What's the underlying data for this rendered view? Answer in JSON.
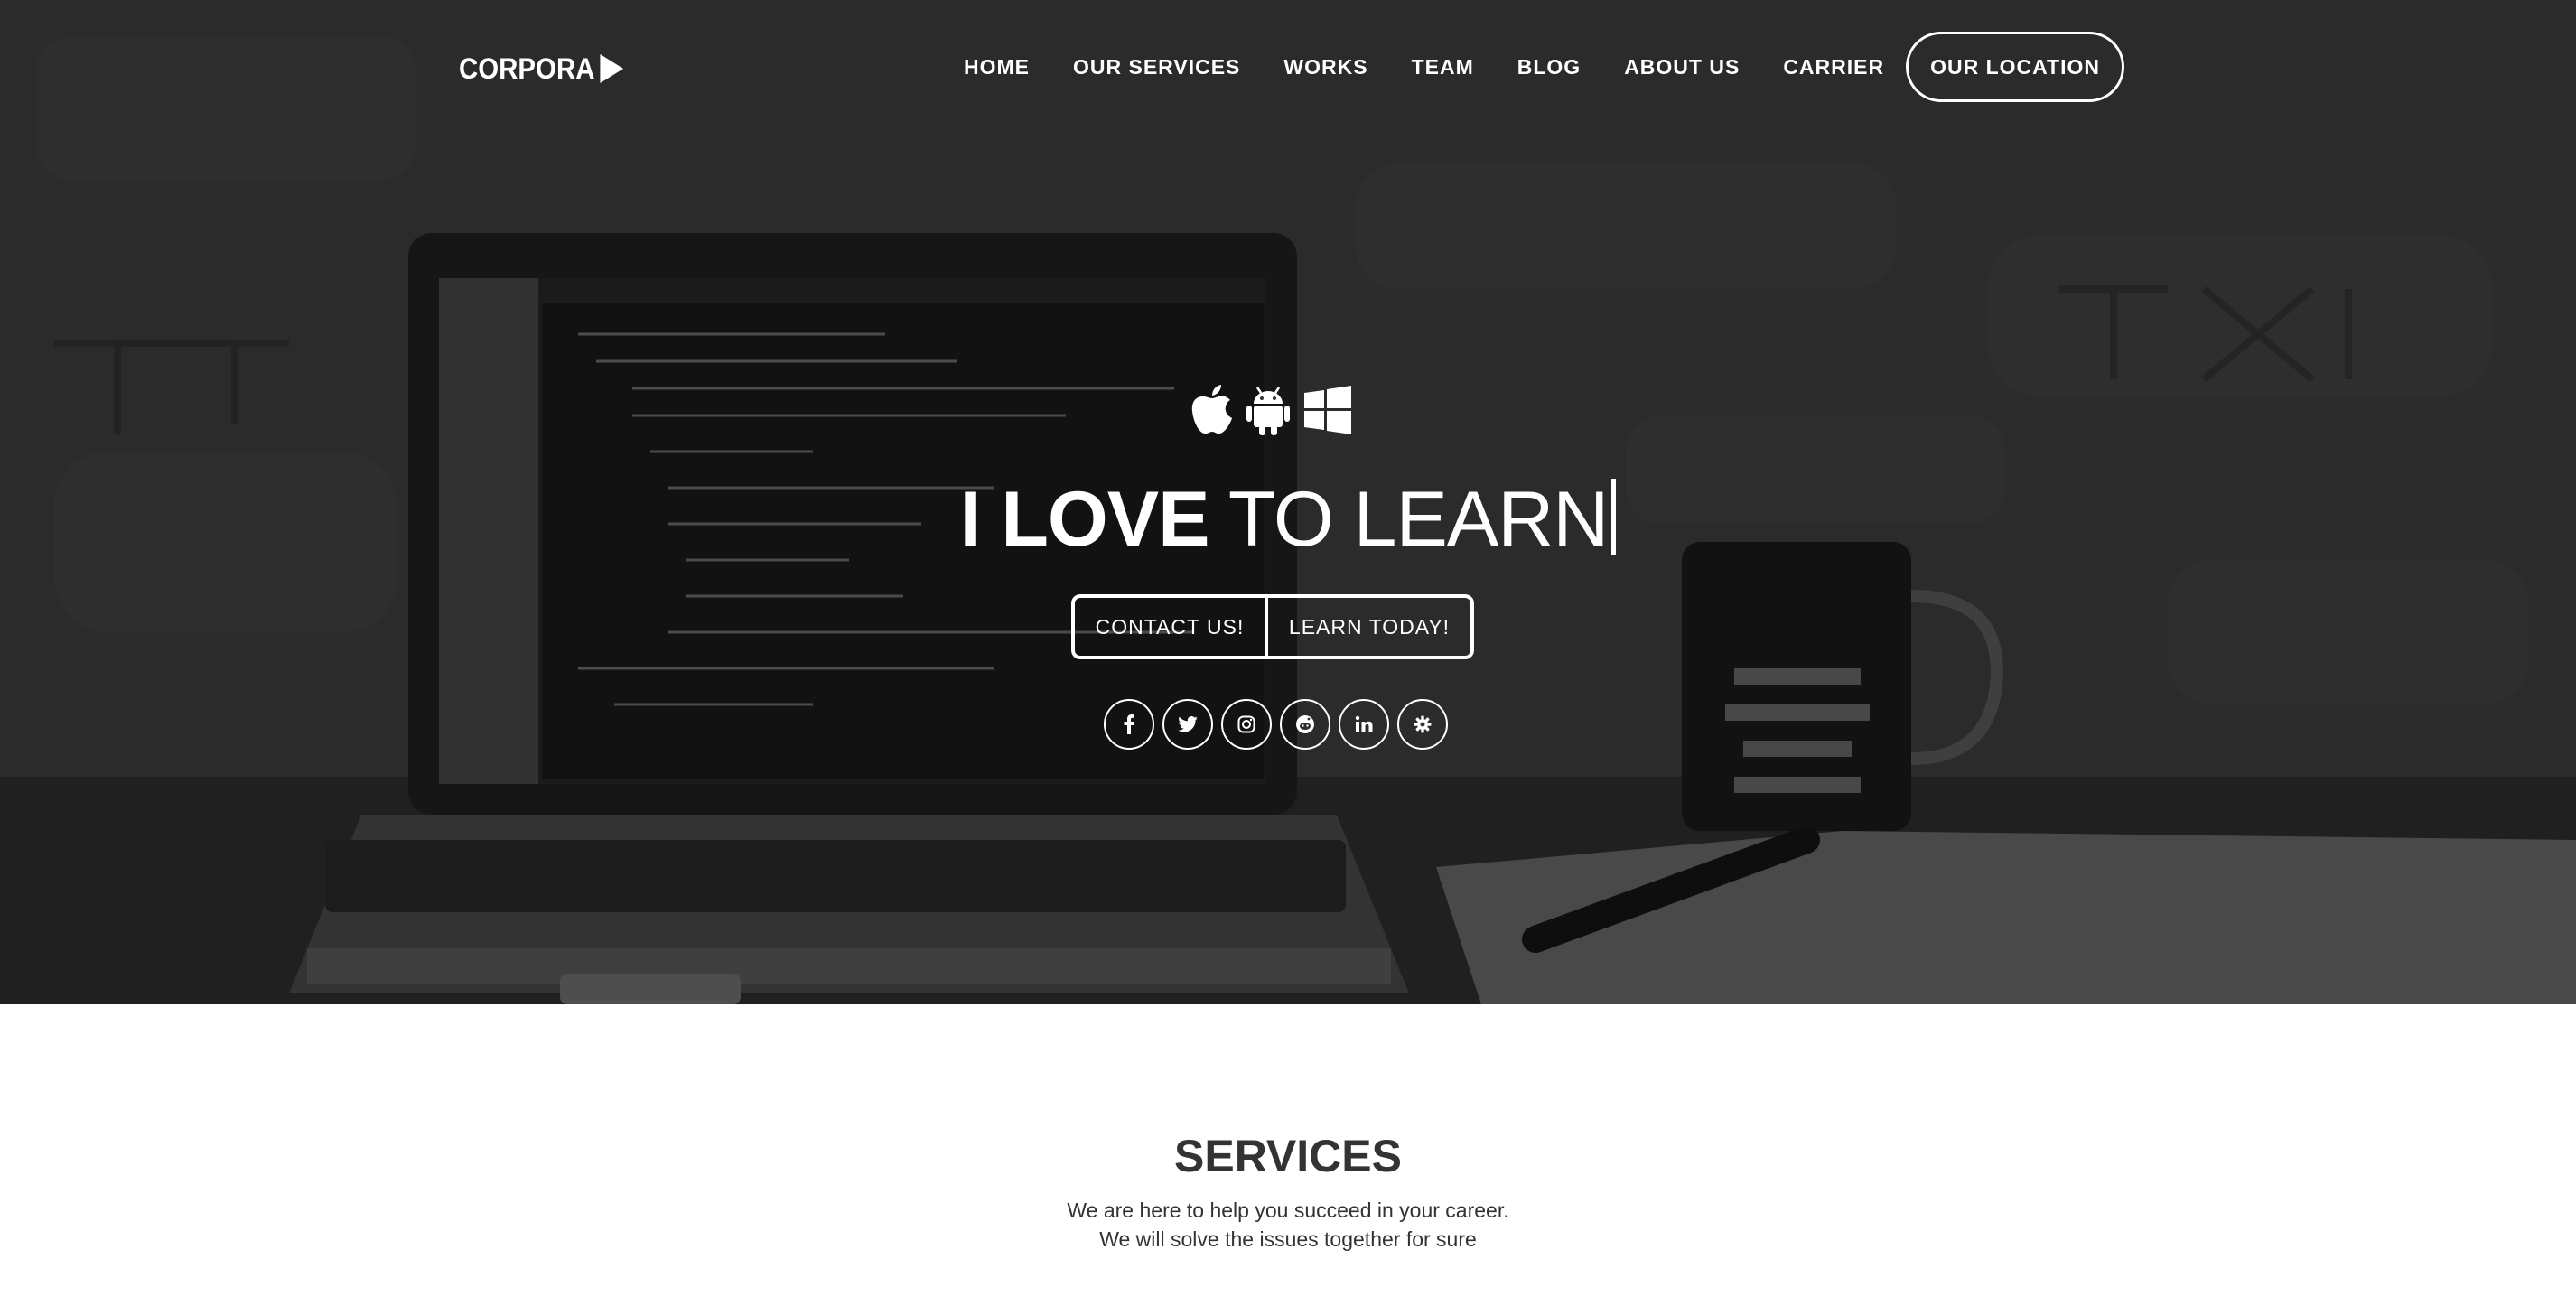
{
  "header": {
    "logo_text": "CORPORA",
    "nav": [
      "HOME",
      "OUR SERVICES",
      "WORKS",
      "TEAM",
      "BLOG",
      "ABOUT US",
      "CARRIER"
    ],
    "location_button": "OUR LOCATION"
  },
  "hero": {
    "platform_icons": [
      "apple-icon",
      "android-icon",
      "windows-icon"
    ],
    "title_bold": "I LOVE",
    "title_rest": " TO LEARN",
    "buttons": [
      "CONTACT US!",
      "LEARN TODAY!"
    ],
    "social_icons": [
      "facebook-icon",
      "twitter-icon",
      "instagram-icon",
      "reddit-icon",
      "linkedin-icon",
      "gear-icon"
    ],
    "social_glyphs": [
      "f",
      "🐦",
      "◎",
      "◉",
      "in",
      "⚙"
    ]
  },
  "services": {
    "title": "SERVICES",
    "line1": "We are here to help you succeed in your career.",
    "line2": "We will solve the issues together for sure"
  }
}
